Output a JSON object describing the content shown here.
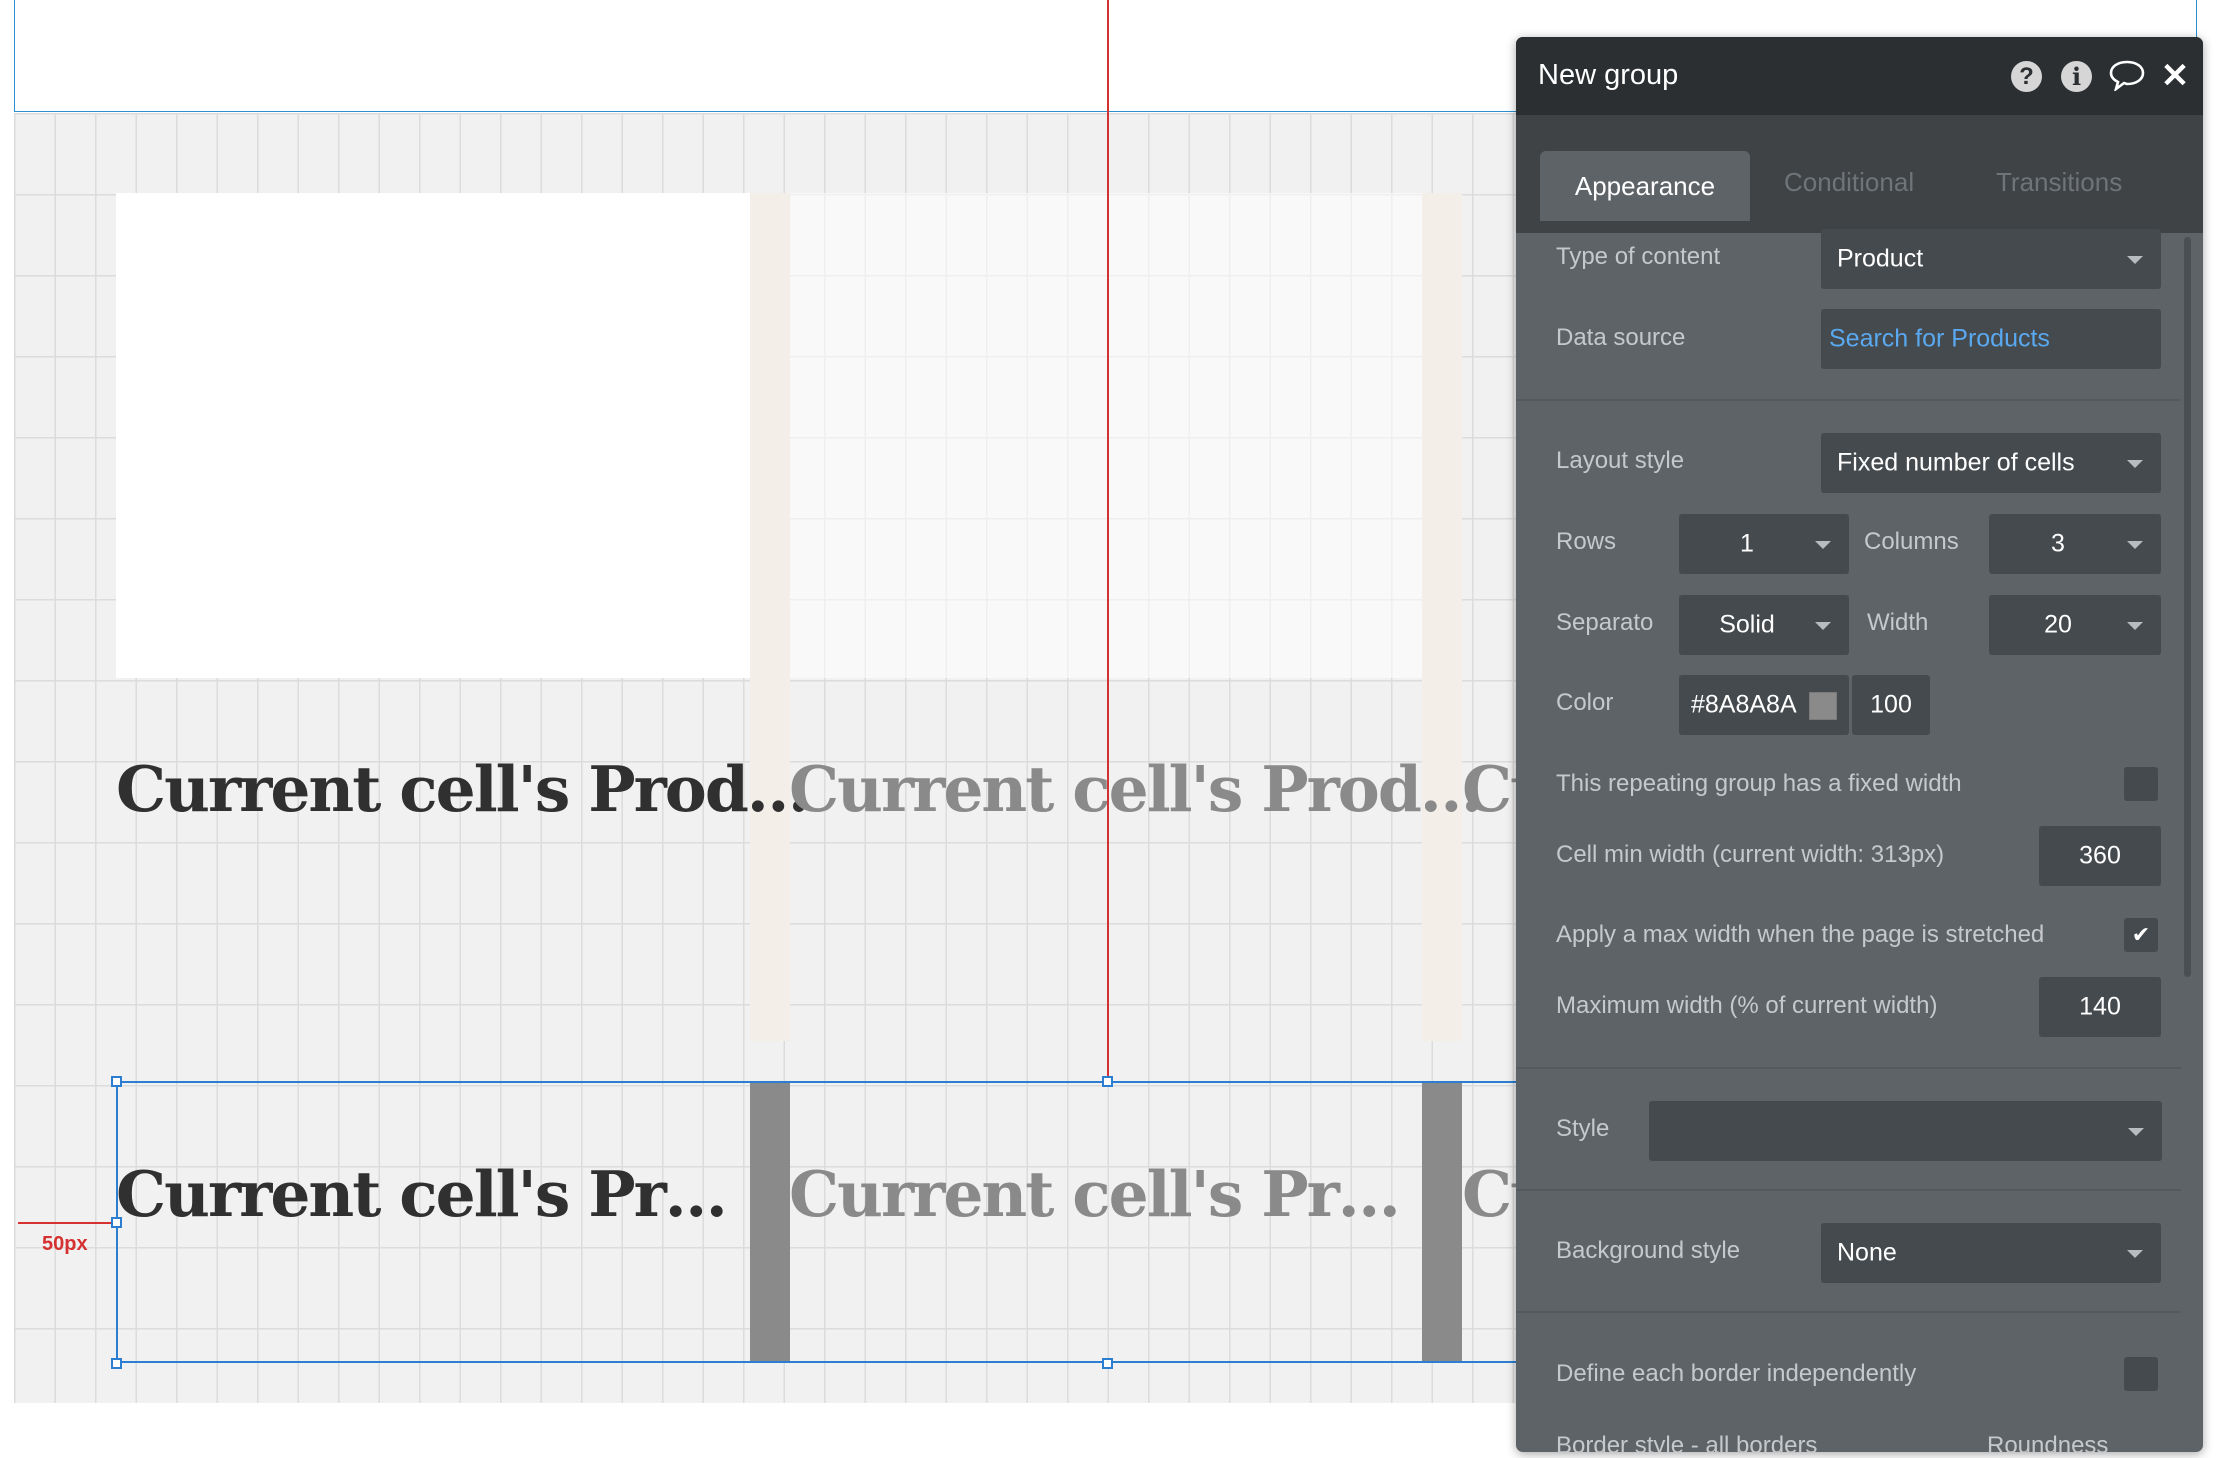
{
  "canvas": {
    "cells": [
      {
        "text_top": "Current cell's Prod…",
        "text_bottom": "Current cell's Pr…",
        "faded": false
      },
      {
        "text_top": "Current cell's Prod…",
        "text_bottom": "Current cell's Pr…",
        "faded": true
      },
      {
        "text_top": "Cu",
        "text_bottom": "Cu",
        "faded": true
      }
    ],
    "distance_label": "50px"
  },
  "panel": {
    "title": "New group",
    "icons": [
      "help-icon",
      "info-icon",
      "comment-icon",
      "close-icon"
    ],
    "tabs": {
      "appearance": "Appearance",
      "conditional": "Conditional",
      "transitions": "Transitions"
    },
    "type_of_content": {
      "label": "Type of content",
      "value": "Product"
    },
    "data_source": {
      "label": "Data source",
      "value": "Search for Products"
    },
    "layout_style": {
      "label": "Layout style",
      "value": "Fixed number of cells"
    },
    "rows": {
      "label": "Rows",
      "value": "1"
    },
    "columns": {
      "label": "Columns",
      "value": "3"
    },
    "separator": {
      "label": "Separato",
      "value": "Solid"
    },
    "width": {
      "label": "Width",
      "value": "20"
    },
    "color": {
      "label": "Color",
      "hex": "#8A8A8A",
      "opacity": "100",
      "swatch": "#8a8a8a"
    },
    "fixed_width": {
      "label": "This repeating group has a fixed width",
      "checked": false
    },
    "cell_min_width": {
      "label": "Cell min width (current width: 313px)",
      "value": "360"
    },
    "max_width_toggle": {
      "label": "Apply a max width when the page is stretched",
      "checked": true
    },
    "max_width": {
      "label": "Maximum width (% of current width)",
      "value": "140"
    },
    "style": {
      "label": "Style",
      "value": ""
    },
    "background_style": {
      "label": "Background style",
      "value": "None"
    },
    "borders_independent": {
      "label": "Define each border independently",
      "checked": false
    },
    "border_style": {
      "label": "Border style - all borders"
    },
    "roundness": {
      "label": "Roundness"
    }
  },
  "colors": {
    "accent": "#2c7ed0",
    "guide": "#d63131",
    "panel_bg": "#5e6367",
    "header_bg": "#2b2f32",
    "link": "#5aa8ef"
  }
}
